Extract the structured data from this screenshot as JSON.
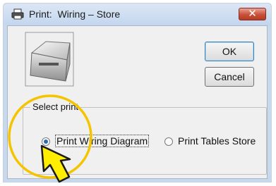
{
  "window": {
    "title": "Print:  Wiring – Store",
    "title_icon": "printer-icon",
    "close_icon": "close-icon",
    "close_glyph": "✕"
  },
  "buttons": {
    "ok_label": "OK",
    "cancel_label": "Cancel"
  },
  "printer_image": "printer-illustration",
  "select_print": {
    "group_label": "Select print",
    "options": [
      {
        "label": "Print Wiring Diagram",
        "selected": true
      },
      {
        "label": "Print Tables Store",
        "selected": false
      }
    ]
  },
  "annotation": {
    "highlight_color": "#f5c400",
    "arrow_color": "#ffee00"
  }
}
